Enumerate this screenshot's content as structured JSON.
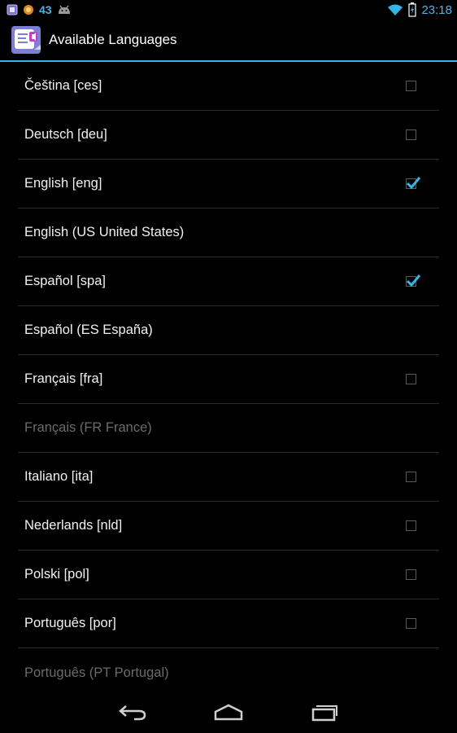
{
  "status_bar": {
    "notification_count": "43",
    "time": "23:18",
    "icons": [
      "app-notification-icon",
      "orange-circle-icon",
      "android-icon",
      "wifi-icon",
      "battery-icon"
    ]
  },
  "action_bar": {
    "title": "Available Languages",
    "icon": "speech-bubble-icon"
  },
  "languages": [
    {
      "label": "Čeština [ces]",
      "checkbox": true,
      "checked": false,
      "enabled": true
    },
    {
      "label": "Deutsch [deu]",
      "checkbox": true,
      "checked": false,
      "enabled": true
    },
    {
      "label": "English [eng]",
      "checkbox": true,
      "checked": true,
      "enabled": true
    },
    {
      "label": "English (US United States)",
      "checkbox": false,
      "checked": false,
      "enabled": true
    },
    {
      "label": "Español [spa]",
      "checkbox": true,
      "checked": true,
      "enabled": true
    },
    {
      "label": "Español (ES España)",
      "checkbox": false,
      "checked": false,
      "enabled": true
    },
    {
      "label": "Français [fra]",
      "checkbox": true,
      "checked": false,
      "enabled": true
    },
    {
      "label": "Français (FR France)",
      "checkbox": false,
      "checked": false,
      "enabled": false
    },
    {
      "label": "Italiano [ita]",
      "checkbox": true,
      "checked": false,
      "enabled": true
    },
    {
      "label": "Nederlands [nld]",
      "checkbox": true,
      "checked": false,
      "enabled": true
    },
    {
      "label": "Polski [pol]",
      "checkbox": true,
      "checked": false,
      "enabled": true
    },
    {
      "label": "Português [por]",
      "checkbox": true,
      "checked": false,
      "enabled": true
    },
    {
      "label": "Português (PT Portugal)",
      "checkbox": false,
      "checked": false,
      "enabled": false
    }
  ],
  "colors": {
    "accent": "#33b5e5",
    "background": "#000000",
    "disabled_text": "#6b6b6b"
  },
  "navigation": [
    "back-icon",
    "home-icon",
    "recent-apps-icon"
  ]
}
